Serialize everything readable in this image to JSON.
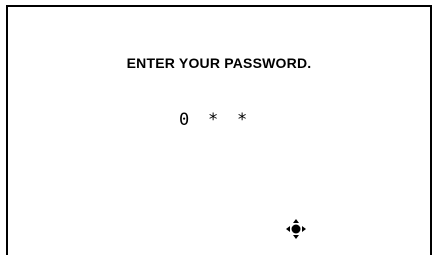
{
  "prompt": "ENTER YOUR PASSWORD.",
  "password_digits": [
    "0",
    "*",
    "*"
  ],
  "icons": {
    "navigation": "four-way-navigation-icon"
  }
}
